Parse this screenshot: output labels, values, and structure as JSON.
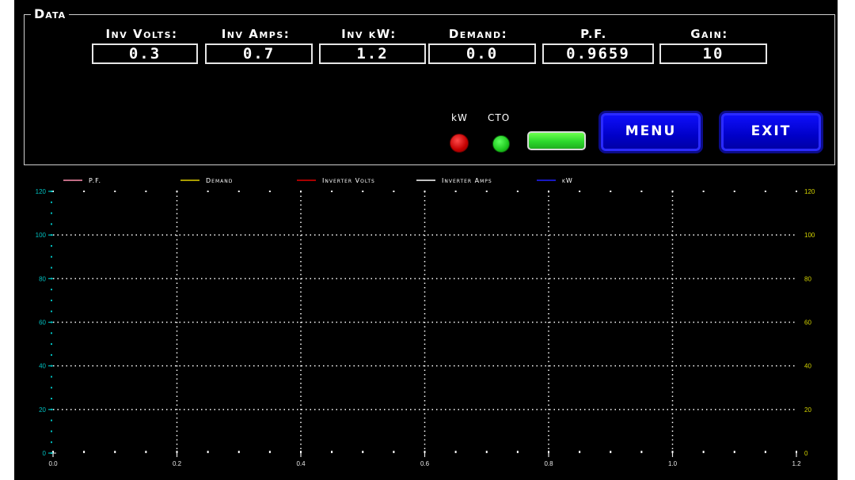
{
  "data_panel": {
    "title": "Data",
    "fields": [
      {
        "label": "Inv Volts:",
        "value": "0.3"
      },
      {
        "label": "Inv Amps:",
        "value": "0.7"
      },
      {
        "label": "Inv kW:",
        "value": "1.2"
      },
      {
        "label": "Demand:",
        "value": "0.0"
      },
      {
        "label": "P.F.",
        "value": "0.9659"
      },
      {
        "label": "Gain:",
        "value": "10"
      }
    ]
  },
  "indicators": {
    "kw_label": "kW",
    "cto_label": "CTO",
    "kw_color": "#e00000",
    "cto_color": "#22cc22",
    "status_color": "#3ae63a"
  },
  "buttons": {
    "menu": "MENU",
    "exit": "EXIT",
    "color": "#0000e0"
  },
  "chart_data": {
    "type": "line",
    "series": [
      {
        "name": "P.F.",
        "color": "#ff8fb0",
        "values": []
      },
      {
        "name": "Demand",
        "color": "#e0d000",
        "values": []
      },
      {
        "name": "Inverter Volts",
        "color": "#e00000",
        "values": []
      },
      {
        "name": "Inverter Amps",
        "color": "#ffffff",
        "values": []
      },
      {
        "name": "kW",
        "color": "#2020ff",
        "values": []
      }
    ],
    "xlim": [
      0,
      1.2
    ],
    "ylim": [
      0,
      120
    ],
    "y2lim": [
      0,
      120
    ],
    "x_ticks": [
      "0.0",
      "0.2",
      "0.4",
      "0.6",
      "0.8",
      "1.0",
      "1.2"
    ],
    "y_ticks": [
      "0",
      "20",
      "40",
      "60",
      "80",
      "100",
      "120"
    ],
    "y2_ticks": [
      "0",
      "20",
      "40",
      "60",
      "80",
      "100",
      "120"
    ],
    "grid": true,
    "legend_position": "top",
    "left_axis_color": "#00c0c0",
    "right_axis_color": "#d4d400"
  }
}
